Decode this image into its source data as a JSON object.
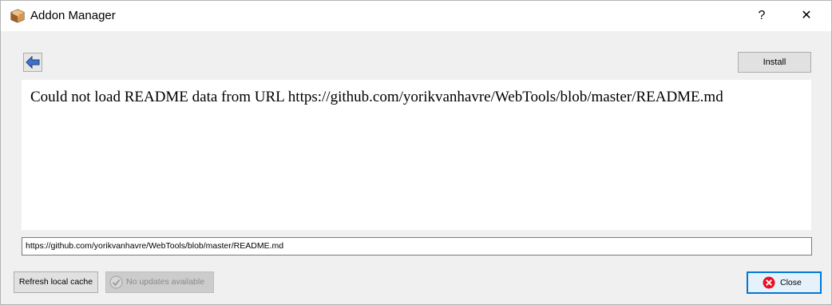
{
  "window": {
    "title": "Addon Manager",
    "help_glyph": "?",
    "close_glyph": "✕"
  },
  "toolbar": {
    "back_icon": "back-arrow-icon",
    "install_label": "Install"
  },
  "readme": {
    "message": "Could not load README data from URL https://github.com/yorikvanhavre/WebTools/blob/master/README.md"
  },
  "url_field": {
    "value": "https://github.com/yorikvanhavre/WebTools/blob/master/README.md"
  },
  "footer": {
    "refresh_label": "Refresh local cache",
    "updates_label": "No updates available",
    "close_label": "Close"
  },
  "colors": {
    "accent": "#0078d7",
    "close_icon_red": "#e81123",
    "back_arrow_blue": "#3f73c9"
  }
}
